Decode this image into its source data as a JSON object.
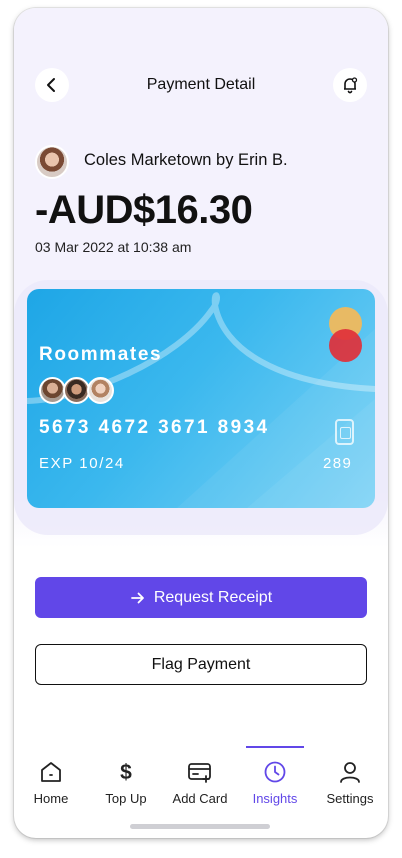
{
  "header": {
    "title": "Payment Detail",
    "back_icon": "chevron-left-icon",
    "bell_icon": "bell-icon"
  },
  "transaction": {
    "merchant": "Coles Marketown by Erin B.",
    "amount": "-AUD$16.30",
    "datetime": "03 Mar 2022 at 10:38 am"
  },
  "card": {
    "name": "Roommates",
    "number": "5673 4672 3671 8934",
    "expiry": "EXP 10/24",
    "cvv": "289",
    "gradient_start": "#1ea6e6",
    "gradient_end": "#7dd3f6",
    "members_count": 3
  },
  "actions": {
    "request_receipt": "Request Receipt",
    "flag_payment": "Flag Payment"
  },
  "tabs": [
    {
      "label": "Home",
      "icon": "home-icon",
      "active": false
    },
    {
      "label": "Top Up",
      "icon": "dollar-icon",
      "active": false
    },
    {
      "label": "Add Card",
      "icon": "add-card-icon",
      "active": false
    },
    {
      "label": "Insights",
      "icon": "clock-icon",
      "active": true
    },
    {
      "label": "Settings",
      "icon": "user-icon",
      "active": false
    }
  ],
  "colors": {
    "accent": "#6147e8",
    "background_top": "#f4f2fd"
  }
}
